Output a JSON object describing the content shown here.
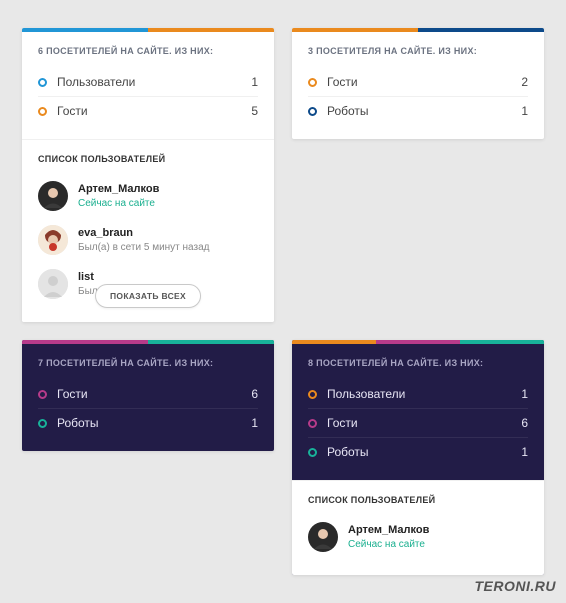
{
  "colors": {
    "blue": "#2196d6",
    "orange": "#ea8a1e",
    "pink": "#b73b8a",
    "teal": "#18b29a",
    "darknavy": "#0d4a8a"
  },
  "watermark": "TERONI.RU",
  "cards": [
    {
      "variant": "light",
      "topbar": [
        "blue",
        "orange"
      ],
      "header": "6 ПОСЕТИТЕЛЕЙ НА САЙТЕ. ИЗ НИХ:",
      "rows": [
        {
          "bullet": "blue",
          "label": "Пользователи",
          "count": "1"
        },
        {
          "bullet": "orange",
          "label": "Гости",
          "count": "5"
        }
      ],
      "usersHeader": "СПИСОК ПОЛЬЗОВАТЕЛЕЙ",
      "users": [
        {
          "avatar": "artem",
          "name": "Артем_Малков",
          "status": "Сейчас на сайте",
          "online": true
        },
        {
          "avatar": "eva",
          "name": "eva_braun",
          "status": "Был(а) в сети 5 минут назад",
          "online": false
        },
        {
          "avatar": "placeholder",
          "name": "list",
          "status": "Был(а) в сети ... назад",
          "online": false
        }
      ],
      "showAll": "ПОКАЗАТЬ ВСЕХ"
    },
    {
      "variant": "light",
      "topbar": [
        "orange",
        "darknavy"
      ],
      "header": "3 ПОСЕТИТЕЛЯ НА САЙТЕ. ИЗ НИХ:",
      "rows": [
        {
          "bullet": "orange",
          "label": "Гости",
          "count": "2"
        },
        {
          "bullet": "darknavy",
          "label": "Роботы",
          "count": "1"
        }
      ]
    },
    {
      "variant": "dark",
      "topbar": [
        "pink",
        "teal"
      ],
      "header": "7 ПОСЕТИТЕЛЕЙ НА САЙТЕ. ИЗ НИХ:",
      "rows": [
        {
          "bullet": "pink",
          "label": "Гости",
          "count": "6"
        },
        {
          "bullet": "teal",
          "label": "Роботы",
          "count": "1"
        }
      ]
    },
    {
      "variant": "dark",
      "topbar": [
        "orange",
        "pink",
        "teal"
      ],
      "header": "8 ПОСЕТИТЕЛЕЙ НА САЙТЕ. ИЗ НИХ:",
      "rows": [
        {
          "bullet": "orange",
          "label": "Пользователи",
          "count": "1"
        },
        {
          "bullet": "pink",
          "label": "Гости",
          "count": "6"
        },
        {
          "bullet": "teal",
          "label": "Роботы",
          "count": "1"
        }
      ],
      "usersHeader": "СПИСОК ПОЛЬЗОВАТЕЛЕЙ",
      "users": [
        {
          "avatar": "artem",
          "name": "Артем_Малков",
          "status": "Сейчас на сайте",
          "online": true
        }
      ]
    }
  ]
}
